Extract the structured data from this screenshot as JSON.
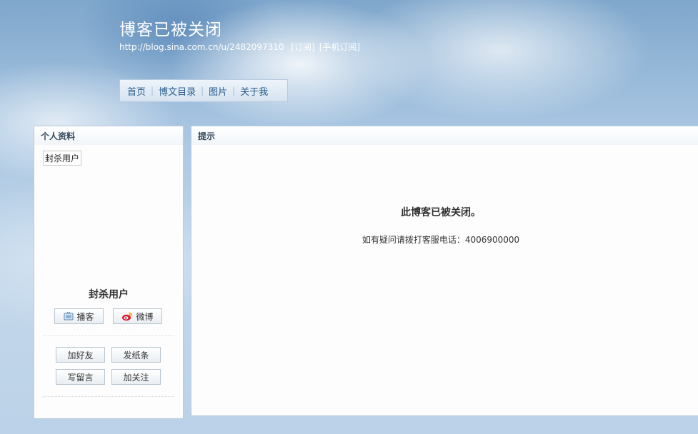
{
  "header": {
    "title": "博客已被关闭",
    "url": "http://blog.sina.com.cn/u/2482097310",
    "subscribe": "[订阅]",
    "mobile_subscribe": "[手机订阅]"
  },
  "nav": {
    "items": [
      "首页",
      "博文目录",
      "图片",
      "关于我"
    ]
  },
  "profile": {
    "heading": "个人资料",
    "tag": "封杀用户",
    "name": "封杀用户",
    "share_buttons": [
      {
        "label": "播客",
        "icon": "tv-icon"
      },
      {
        "label": "微博",
        "icon": "weibo-icon"
      }
    ],
    "action_buttons": [
      "加好友",
      "发纸条",
      "写留言",
      "加关注"
    ]
  },
  "notice": {
    "heading": "提示",
    "title": "此博客已被关闭。",
    "detail": "如有疑问请拨打客服电话：4006900000"
  },
  "colors": {
    "nav_link": "#2b5d8f",
    "panel_border": "#b9cbdc"
  }
}
